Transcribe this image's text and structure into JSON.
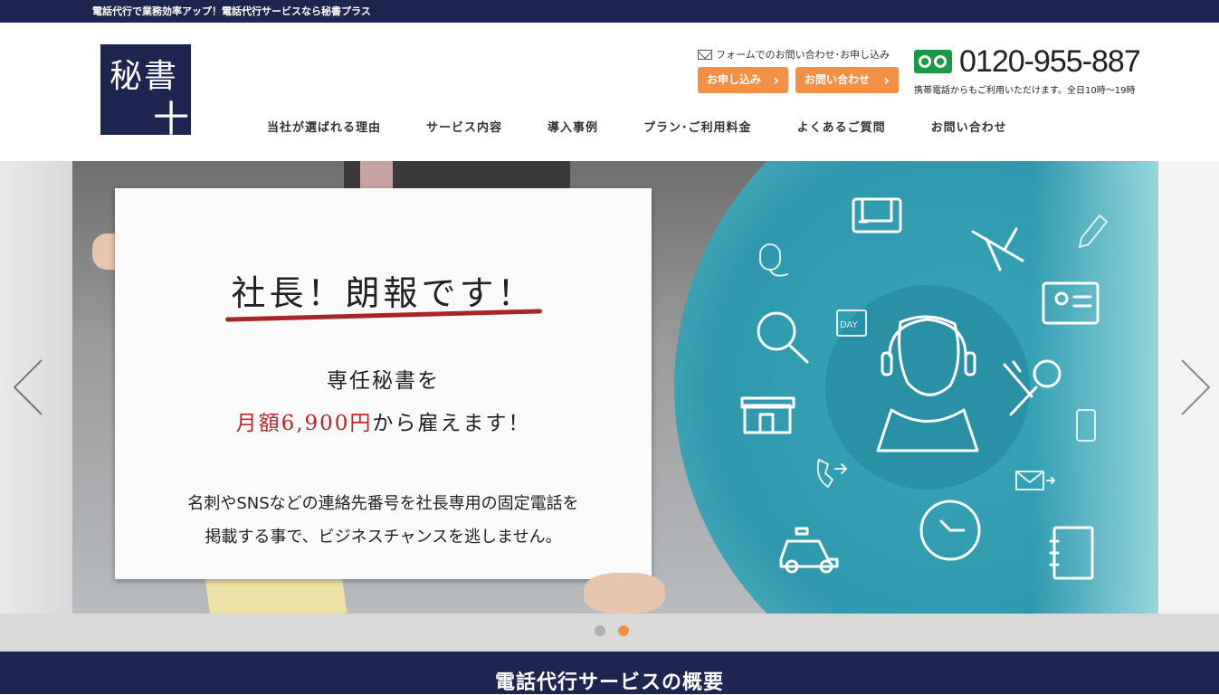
{
  "topbar": {
    "text": "電話代行で業務効率アップ！電話代行サービスなら秘書プラス"
  },
  "logo": {
    "line1": "秘書",
    "line2": "十"
  },
  "contact": {
    "form_label": "フォームでのお問い合わせ･お申し込み",
    "apply_label": "お申し込み",
    "inquiry_label": "お問い合わせ",
    "phone_number": "0120-955-887",
    "phone_note": "携帯電話からもご利用いただけます。全日10時〜19時"
  },
  "nav": {
    "items": [
      "当社が選ばれる理由",
      "サービス内容",
      "導入事例",
      "プラン･ご利用料金",
      "よくあるご質問",
      "お問い合わせ"
    ]
  },
  "hero": {
    "headline": "社長！朗報です！",
    "sub": "専任秘書を",
    "price_red": "月額6,900円",
    "price_rest": "から雇えます！",
    "desc_line1": "名刺やSNSなどの連絡先番号を社長専用の固定電話を",
    "desc_line2": "掲載する事で、ビジネスチャンスを逃しません。",
    "icons": [
      "fax-icon",
      "airplane-icon",
      "pencil-icon",
      "mouse-icon",
      "calendar-day-icon",
      "id-card-icon",
      "magnifier-icon",
      "operator-icon",
      "utensils-icon",
      "store-icon",
      "smartphone-icon",
      "phone-forward-icon",
      "mail-forward-icon",
      "clock-icon",
      "taxi-icon",
      "notebook-icon"
    ],
    "calendar_text": "DAY"
  },
  "section": {
    "title": "電話代行サービスの概要"
  },
  "colors": {
    "navy": "#1e2550",
    "orange": "#f29046",
    "green": "#1a9a48",
    "teal": "#2f98ad",
    "red": "#b8282b"
  }
}
